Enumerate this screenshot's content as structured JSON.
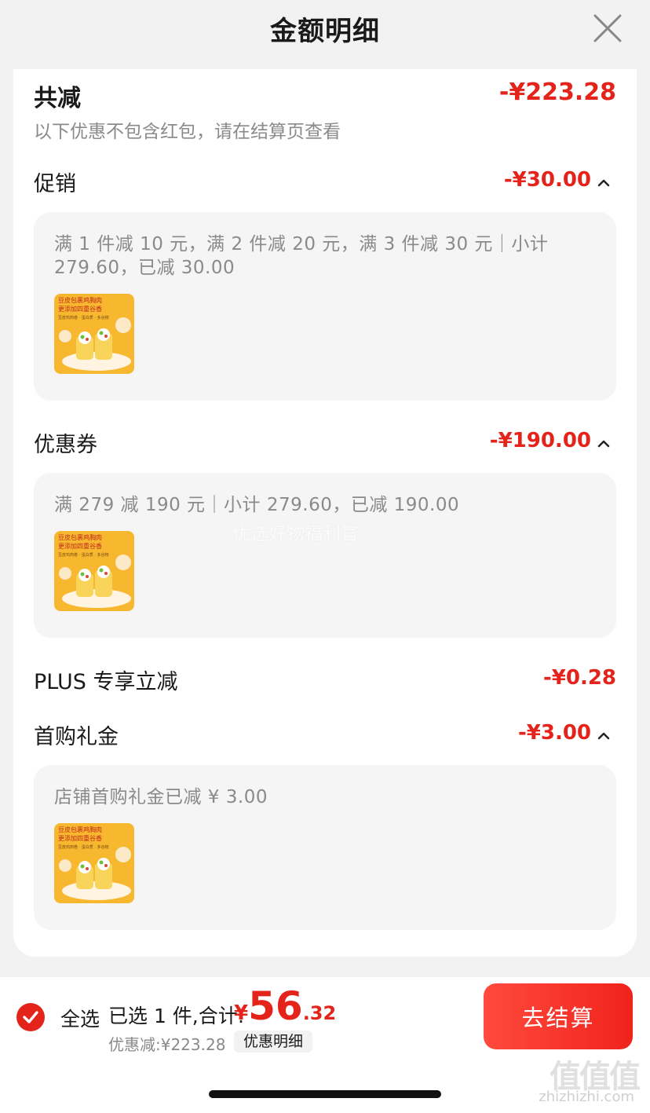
{
  "header": {
    "title": "金额明细",
    "close_icon": "close-icon"
  },
  "summary": {
    "label": "共减",
    "value": "-¥223.28",
    "note": "以下优惠不包含红包，请在结算页查看"
  },
  "sections": {
    "promo": {
      "label": "促销",
      "value": "-¥30.00",
      "desc": "满 1 件减 10 元，满 2 件减 20 元，满 3 件减 30 元｜小计 279.60，已减 30.00"
    },
    "coupon": {
      "label": "优惠券",
      "value": "-¥190.00",
      "desc": "满 279 减 190 元｜小计 279.60，已减 190.00"
    },
    "plus": {
      "label": "PLUS 专享立减",
      "value": "-¥0.28"
    },
    "first": {
      "label": "首购礼金",
      "value": "-¥3.00",
      "desc": "店铺首购礼金已减 ¥ 3.00"
    }
  },
  "product_thumb": {
    "line1": "豆皮包裹鸡胸肉",
    "line2": "更添加四重谷香",
    "line3": "豆皮鸡肉卷 · 蛋白质 · 多谷物"
  },
  "watermark": "优选好物福利官",
  "bottom_bar": {
    "select_all": "全选",
    "selected": "已选 1 件,合计:",
    "price_symbol": "¥",
    "price_int": "56",
    "price_dec": ".32",
    "discount": "优惠减:¥223.28",
    "detail_link": "优惠明细",
    "checkout": "去结算"
  },
  "site_mark": {
    "big": "值值值",
    "small": "zhizhizhi.com"
  },
  "colors": {
    "accent": "#e4231b",
    "muted": "#8a8a8a",
    "card_bg": "#f5f5f5"
  }
}
